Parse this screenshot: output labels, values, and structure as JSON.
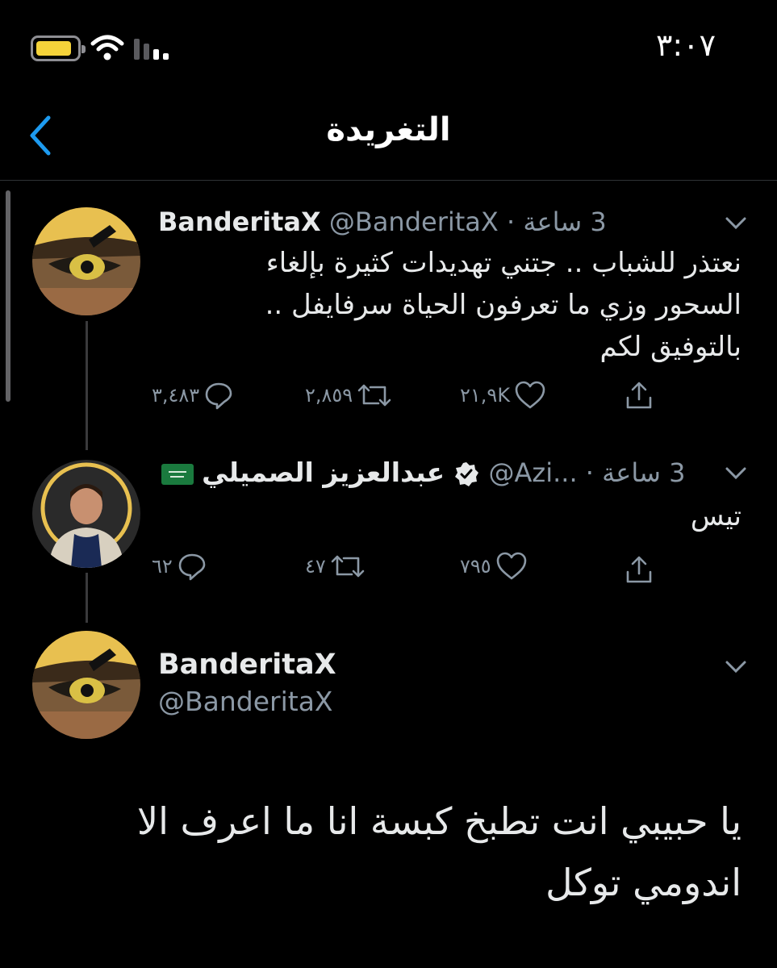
{
  "status_bar": {
    "time": "٣:٠٧",
    "battery_color": "#f5d33a",
    "battery_level": 0.9,
    "icons": [
      "battery-icon",
      "wifi-icon",
      "signal-icon"
    ]
  },
  "header": {
    "title": "التغريدة",
    "back_icon": "chevron-left-icon"
  },
  "tweets": [
    {
      "name": "BanderitaX",
      "handle": "@BanderitaX",
      "separator": "·",
      "time": "3 ساعة",
      "text": "نعتذر للشباب .. جتني تهديدات كثيرة بإلغاء\nالسحور وزي ما تعرفون الحياة سرفايفل ..\nبالتوفيق لكم",
      "replies": "٣,٤٨٣",
      "retweets": "٢,٨٥٩",
      "likes": "٢١,٩K"
    },
    {
      "name": "عبدالعزيز الصميلي",
      "handle": "@Azi...",
      "separator": "·",
      "time": "3 ساعة",
      "text": "تيس",
      "replies": "٦٢",
      "retweets": "٤٧",
      "likes": "٧٩٥"
    }
  ],
  "main_tweet": {
    "name": "BanderitaX",
    "handle": "@BanderitaX",
    "text": "يا حبيبي انت تطبخ كبسة انا ما اعرف الا\nاندومي توكل"
  },
  "colors": {
    "accent": "#1d9bf0",
    "muted": "#8b98a5",
    "background": "#000000"
  }
}
